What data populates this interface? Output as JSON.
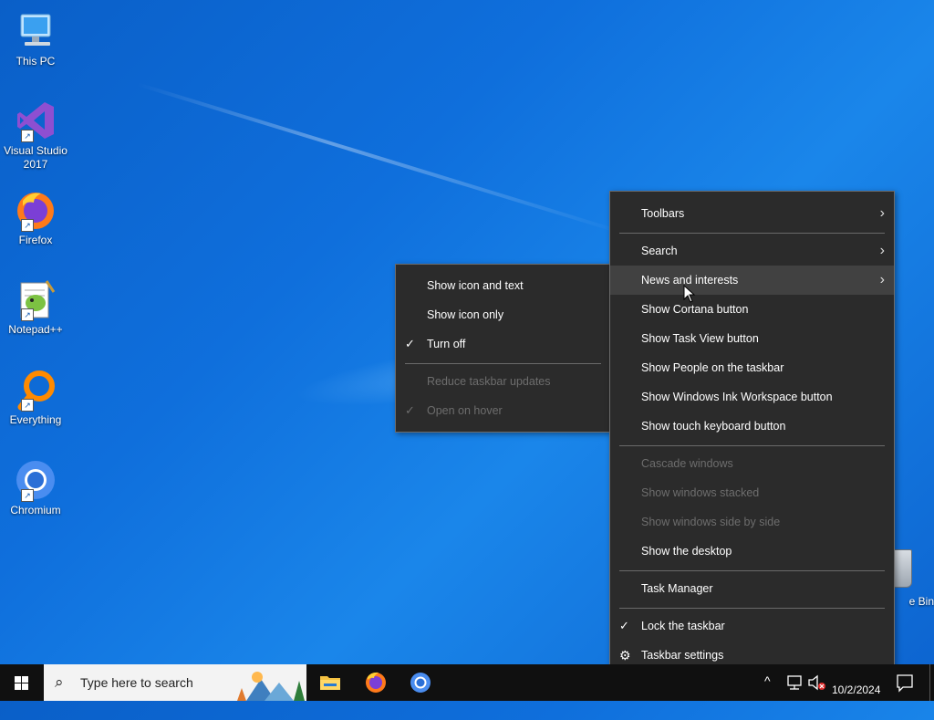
{
  "desktop": {
    "icons": [
      {
        "label": "This PC"
      },
      {
        "label": "Visual Studio 2017"
      },
      {
        "label": "Firefox"
      },
      {
        "label": "Notepad++"
      },
      {
        "label": "Everything"
      },
      {
        "label": "Chromium"
      }
    ],
    "recycle_bin_label": "e Bin"
  },
  "main_menu": {
    "items": [
      {
        "label": "Toolbars"
      },
      {
        "label": "Search"
      },
      {
        "label": "News and interests"
      },
      {
        "label": "Show Cortana button"
      },
      {
        "label": "Show Task View button"
      },
      {
        "label": "Show People on the taskbar"
      },
      {
        "label": "Show Windows Ink Workspace button"
      },
      {
        "label": "Show touch keyboard button"
      },
      {
        "label": "Cascade windows"
      },
      {
        "label": "Show windows stacked"
      },
      {
        "label": "Show windows side by side"
      },
      {
        "label": "Show the desktop"
      },
      {
        "label": "Task Manager"
      },
      {
        "label": "Lock the taskbar"
      },
      {
        "label": "Taskbar settings"
      }
    ]
  },
  "sub_menu": {
    "items": [
      {
        "label": "Show icon and text"
      },
      {
        "label": "Show icon only"
      },
      {
        "label": "Turn off"
      },
      {
        "label": "Reduce taskbar updates"
      },
      {
        "label": "Open on hover"
      }
    ]
  },
  "glyphs": {
    "chevron": "›",
    "check": "✓",
    "gear": "⚙",
    "magnifier": "⌕",
    "caret_up": "^"
  },
  "taskbar": {
    "search_placeholder": "Type here to search",
    "date": "10/2/2024"
  },
  "colors": {
    "menu_bg": "#2b2b2b",
    "menu_hover": "#414141",
    "disabled_text": "#6d6d6d",
    "taskbar": "#101010"
  }
}
